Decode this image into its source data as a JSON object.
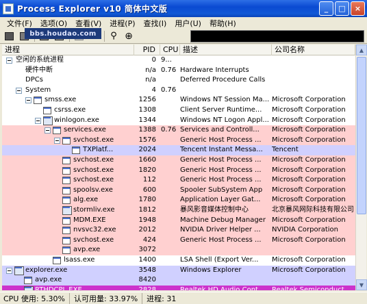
{
  "window": {
    "title": "Process Explorer v10 简体中文版",
    "buttons": [
      "_",
      "□",
      "×"
    ]
  },
  "watermark": "bbs.houdao.com",
  "menu": [
    "文件(F)",
    "选项(O)",
    "查看(V)",
    "进程(P)",
    "查找(I)",
    "用户(U)",
    "帮助(H)"
  ],
  "toolbar_icons": [
    "save-icon",
    "refresh-icon",
    "system-info-icon",
    "cpu-graph-icon",
    "process-properties-icon",
    "kill-process-icon",
    "find-icon",
    "target-icon"
  ],
  "columns": [
    "进程",
    "PID",
    "CPU",
    "描述",
    "公司名称"
  ],
  "colors": {
    "services": "#ffd0d0",
    "own": "#d0d0ff",
    "highlight": "#cc33cc",
    "plain": "#ffffff"
  },
  "processes": [
    {
      "name": "空闲的系统进程",
      "pid": "0",
      "cpu": "9...",
      "desc": "",
      "company": "",
      "level": 0,
      "toggle": true,
      "icon": "none",
      "bg": "plain"
    },
    {
      "name": "硬件中断",
      "pid": "n/a",
      "cpu": "0.76",
      "desc": "Hardware Interrupts",
      "company": "",
      "level": 1,
      "toggle": false,
      "icon": "none",
      "bg": "plain"
    },
    {
      "name": "DPCs",
      "pid": "n/a",
      "cpu": "",
      "desc": "Deferred Procedure Calls",
      "company": "",
      "level": 1,
      "toggle": false,
      "icon": "none",
      "bg": "plain"
    },
    {
      "name": "System",
      "pid": "4",
      "cpu": "0.76",
      "desc": "",
      "company": "",
      "level": 1,
      "toggle": true,
      "icon": "none",
      "bg": "plain"
    },
    {
      "name": "smss.exe",
      "pid": "1256",
      "cpu": "",
      "desc": "Windows NT Session Ma...",
      "company": "Microsoft Corporation",
      "level": 2,
      "toggle": true,
      "icon": "window",
      "bg": "plain"
    },
    {
      "name": "csrss.exe",
      "pid": "1308",
      "cpu": "",
      "desc": "Client Server Runtime...",
      "company": "Microsoft Corporation",
      "level": 3,
      "toggle": false,
      "icon": "window",
      "bg": "plain"
    },
    {
      "name": "winlogon.exe",
      "pid": "1344",
      "cpu": "",
      "desc": "Windows NT Logon Appl...",
      "company": "Microsoft Corporation",
      "level": 3,
      "toggle": true,
      "icon": "big",
      "bg": "plain"
    },
    {
      "name": "services.exe",
      "pid": "1388",
      "cpu": "0.76",
      "desc": "Services and Controll...",
      "company": "Microsoft Corporation",
      "level": 4,
      "toggle": true,
      "icon": "window",
      "bg": "services"
    },
    {
      "name": "svchost.exe",
      "pid": "1576",
      "cpu": "",
      "desc": "Generic Host Process ...",
      "company": "Microsoft Corporation",
      "level": 5,
      "toggle": true,
      "icon": "window",
      "bg": "services"
    },
    {
      "name": "TXPlatf...",
      "pid": "2024",
      "cpu": "",
      "desc": "Tencent Instant Messa...",
      "company": "Tencent",
      "level": 6,
      "toggle": false,
      "icon": "window",
      "bg": "own"
    },
    {
      "name": "svchost.exe",
      "pid": "1660",
      "cpu": "",
      "desc": "Generic Host Process ...",
      "company": "Microsoft Corporation",
      "level": 5,
      "toggle": false,
      "icon": "window",
      "bg": "services"
    },
    {
      "name": "svchost.exe",
      "pid": "1820",
      "cpu": "",
      "desc": "Generic Host Process ...",
      "company": "Microsoft Corporation",
      "level": 5,
      "toggle": false,
      "icon": "window",
      "bg": "services"
    },
    {
      "name": "svchost.exe",
      "pid": "112",
      "cpu": "",
      "desc": "Generic Host Process ...",
      "company": "Microsoft Corporation",
      "level": 5,
      "toggle": false,
      "icon": "window",
      "bg": "services"
    },
    {
      "name": "spoolsv.exe",
      "pid": "600",
      "cpu": "",
      "desc": "Spooler SubSystem App",
      "company": "Microsoft Corporation",
      "level": 5,
      "toggle": false,
      "icon": "window",
      "bg": "services"
    },
    {
      "name": "alg.exe",
      "pid": "1780",
      "cpu": "",
      "desc": "Application Layer Gat...",
      "company": "Microsoft Corporation",
      "level": 5,
      "toggle": false,
      "icon": "window",
      "bg": "services"
    },
    {
      "name": "stormliv.exe",
      "pid": "1812",
      "cpu": "",
      "desc": "暴风影音媒体控制中心",
      "company": "北京暴风网际科技有限公司",
      "level": 5,
      "toggle": false,
      "icon": "big",
      "bg": "services"
    },
    {
      "name": "MDM.EXE",
      "pid": "1948",
      "cpu": "",
      "desc": "Machine Debug Manager",
      "company": "Microsoft Corporation",
      "level": 5,
      "toggle": false,
      "icon": "window",
      "bg": "services"
    },
    {
      "name": "nvsvc32.exe",
      "pid": "2012",
      "cpu": "",
      "desc": "NVIDIA Driver Helper ...",
      "company": "NVIDIA Corporation",
      "level": 5,
      "toggle": false,
      "icon": "window",
      "bg": "services"
    },
    {
      "name": "svchost.exe",
      "pid": "424",
      "cpu": "",
      "desc": "Generic Host Process ...",
      "company": "Microsoft Corporation",
      "level": 5,
      "toggle": false,
      "icon": "window",
      "bg": "services"
    },
    {
      "name": "avp.exe",
      "pid": "3072",
      "cpu": "",
      "desc": "",
      "company": "",
      "level": 5,
      "toggle": false,
      "icon": "window",
      "bg": "services"
    },
    {
      "name": "lsass.exe",
      "pid": "1400",
      "cpu": "",
      "desc": "LSA Shell (Export Ver...",
      "company": "Microsoft Corporation",
      "level": 4,
      "toggle": false,
      "icon": "window",
      "bg": "plain"
    },
    {
      "name": "explorer.exe",
      "pid": "3548",
      "cpu": "",
      "desc": "Windows Explorer",
      "company": "Microsoft Corporation",
      "level": 0,
      "toggle": true,
      "icon": "big",
      "bg": "own"
    },
    {
      "name": "avp.exe",
      "pid": "8420",
      "cpu": "",
      "desc": "",
      "company": "",
      "level": 1,
      "toggle": false,
      "icon": "window",
      "bg": "own"
    },
    {
      "name": "RTHDCPL.EXE",
      "pid": "2828",
      "cpu": "",
      "desc": "Realtek HD Audio Cont...",
      "company": "Realtek Semiconduct...",
      "level": 1,
      "toggle": false,
      "icon": "big",
      "bg": "highlight"
    }
  ],
  "status": [
    "CPU 使用: 5.30%",
    "认可用量: 33.97%",
    "进程: 31"
  ]
}
